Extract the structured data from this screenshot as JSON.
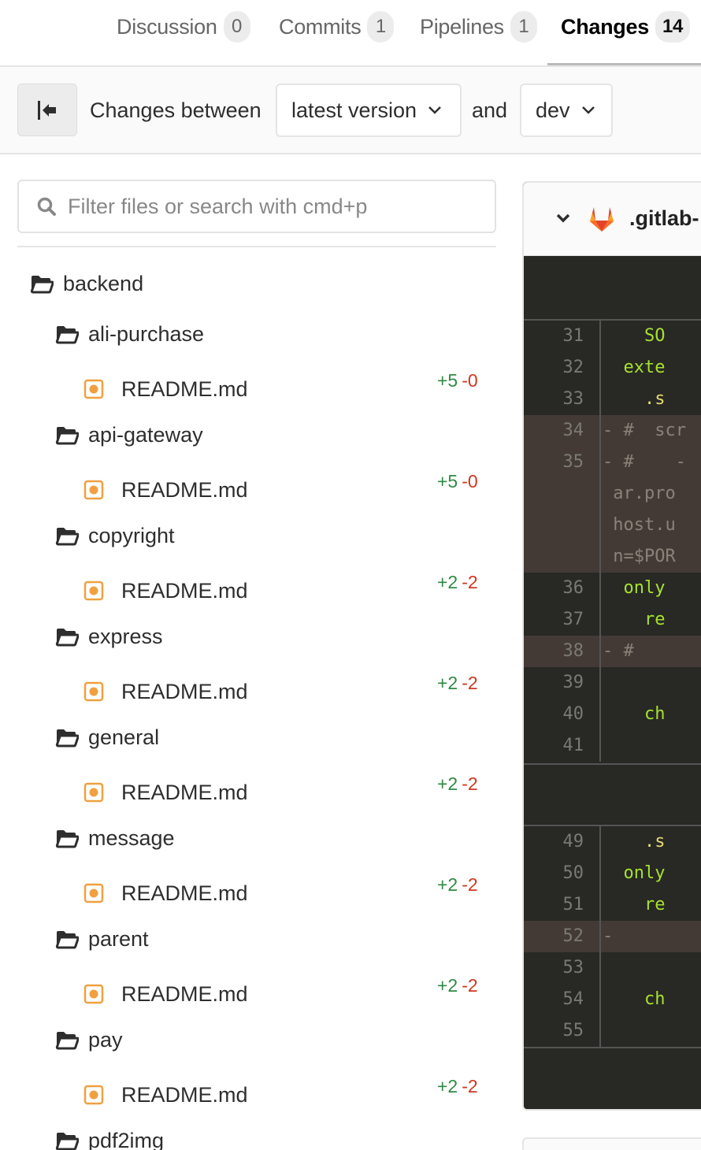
{
  "tabs": [
    {
      "label": "Discussion",
      "count": "0",
      "active": false
    },
    {
      "label": "Commits",
      "count": "1",
      "active": false
    },
    {
      "label": "Pipelines",
      "count": "1",
      "active": false
    },
    {
      "label": "Changes",
      "count": "14",
      "active": true
    }
  ],
  "compare": {
    "toggle_icon": "collapse-sidebar-icon",
    "label_prefix": "Changes between",
    "source_version": "latest version",
    "label_and": "and",
    "target_branch": "dev"
  },
  "sidebar": {
    "filter_placeholder": "Filter files or search with cmd+p",
    "root_folder": "backend",
    "folders": [
      {
        "name": "ali-purchase",
        "file": "README.md",
        "added": "+5",
        "removed": "-0"
      },
      {
        "name": "api-gateway",
        "file": "README.md",
        "added": "+5",
        "removed": "-0"
      },
      {
        "name": "copyright",
        "file": "README.md",
        "added": "+2",
        "removed": "-2"
      },
      {
        "name": "express",
        "file": "README.md",
        "added": "+2",
        "removed": "-2"
      },
      {
        "name": "general",
        "file": "README.md",
        "added": "+2",
        "removed": "-2"
      },
      {
        "name": "message",
        "file": "README.md",
        "added": "+2",
        "removed": "-2"
      },
      {
        "name": "parent",
        "file": "README.md",
        "added": "+2",
        "removed": "-2"
      },
      {
        "name": "pay",
        "file": "README.md",
        "added": "+2",
        "removed": "-2"
      }
    ],
    "last_folder": "pdf2img"
  },
  "diff": {
    "file_name": ".gitlab-",
    "file_icon": "gitlab-logo-icon",
    "lines": [
      {
        "num": "31",
        "type": "context",
        "text": "    SO",
        "cls": "kw"
      },
      {
        "num": "32",
        "type": "context",
        "text": "  exte",
        "cls": "kw"
      },
      {
        "num": "33",
        "type": "context",
        "text": "    .s",
        "cls": "dot"
      },
      {
        "num": "34",
        "type": "old",
        "text": "- #  scr",
        "cls": ""
      },
      {
        "num": "35",
        "type": "old",
        "text": "- #    -",
        "cls": ""
      },
      {
        "num": "",
        "type": "old",
        "text": " ar.pro",
        "cls": ""
      },
      {
        "num": "",
        "type": "old",
        "text": " host.u",
        "cls": ""
      },
      {
        "num": "",
        "type": "old",
        "text": " n=$POR",
        "cls": ""
      },
      {
        "num": "36",
        "type": "context",
        "text": "  only",
        "cls": "kw"
      },
      {
        "num": "37",
        "type": "context",
        "text": "    re",
        "cls": "kw"
      },
      {
        "num": "38",
        "type": "old",
        "text": "- #",
        "cls": ""
      },
      {
        "num": "39",
        "type": "context",
        "text": "",
        "cls": "kw"
      },
      {
        "num": "40",
        "type": "context",
        "text": "    ch",
        "cls": "kw"
      },
      {
        "num": "41",
        "type": "context",
        "text": "",
        "cls": "kw"
      },
      {
        "num": "49",
        "type": "context",
        "text": "    .s",
        "cls": "dot"
      },
      {
        "num": "50",
        "type": "context",
        "text": "  only",
        "cls": "kw"
      },
      {
        "num": "51",
        "type": "context",
        "text": "    re",
        "cls": "kw"
      },
      {
        "num": "52",
        "type": "old",
        "text": "-",
        "cls": ""
      },
      {
        "num": "53",
        "type": "context",
        "text": "",
        "cls": "kw"
      },
      {
        "num": "54",
        "type": "context",
        "text": "    ch",
        "cls": "kw"
      },
      {
        "num": "55",
        "type": "context",
        "text": "",
        "cls": "kw"
      }
    ]
  },
  "colors": {
    "added": "#2f8a45",
    "removed": "#d0371f",
    "modified_file_icon": "#f0a040",
    "code_bg": "#282825",
    "old_line_bg": "#443a35",
    "code_keyword": "#a6e22e"
  }
}
